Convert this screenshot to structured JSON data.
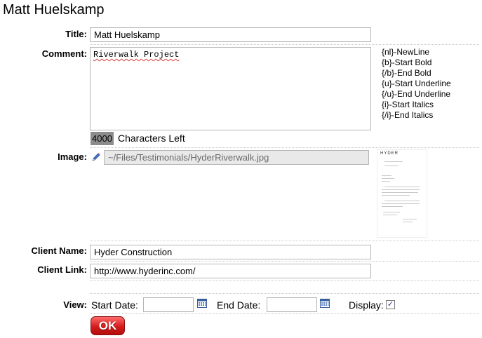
{
  "page": {
    "title": "Matt Huelskamp"
  },
  "form": {
    "title_label": "Title:",
    "title_value": "Matt Huelskamp",
    "comment_label": "Comment:",
    "comment_value": "Riverwalk Project",
    "comment_help": [
      "{nl}-NewLine",
      "{b}-Start Bold",
      "{/b}-End Bold",
      "{u}-Start Underline",
      "{/u}-End Underline",
      "{i}-Start Italics",
      "{/i}-End Italics"
    ],
    "chars_left_count": "4000",
    "chars_left_label": "Characters Left",
    "image_label": "Image:",
    "image_value": "~/Files/Testimonials/HyderRiverwalk.jpg",
    "thumbnail_header": "HYDER",
    "client_name_label": "Client Name:",
    "client_name_value": "Hyder Construction",
    "client_link_label": "Client Link:",
    "client_link_value": "http://www.hyderinc.com/",
    "view_label": "View:",
    "start_date_label": "Start Date:",
    "start_date_value": "",
    "end_date_label": "End Date:",
    "end_date_value": "",
    "display_label": "Display:",
    "display_checked": true,
    "ok_label": "OK"
  },
  "colors": {
    "ok_button": "#d51c1c",
    "counter_bg": "#8c8c8c",
    "link_blue": "#2e5aa8"
  }
}
